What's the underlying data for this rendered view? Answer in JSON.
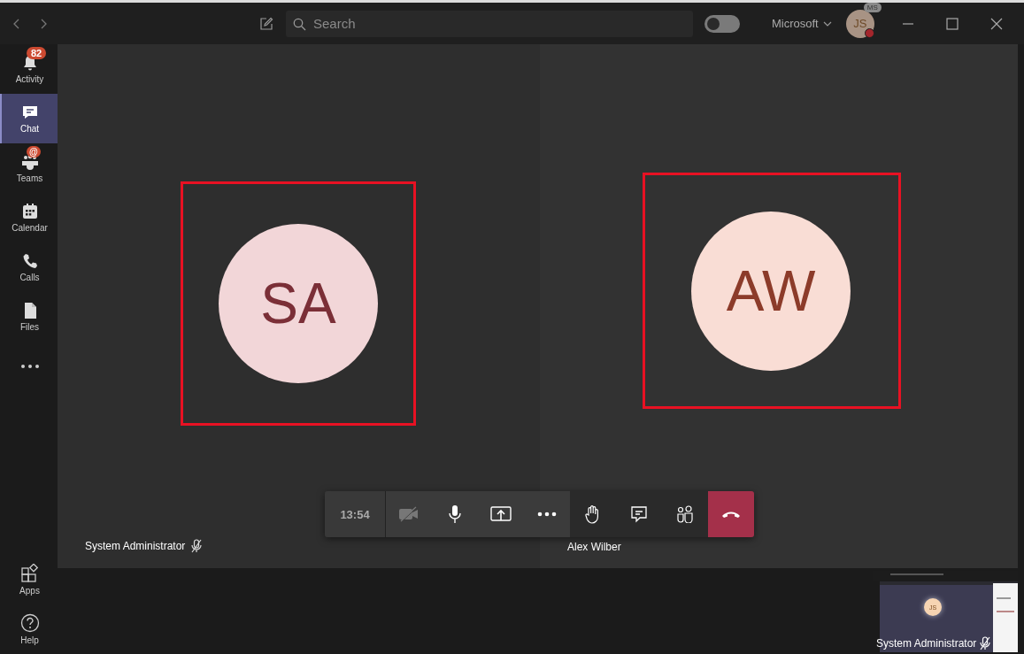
{
  "title_bar": {
    "search_placeholder": "Search",
    "toggle_on": false,
    "org": "Microsoft",
    "avatar_initials": "JS",
    "avatar_badge": "MS"
  },
  "rail": {
    "items": [
      {
        "kind": "bell",
        "label": "Activity",
        "badge": "82",
        "selected": false
      },
      {
        "kind": "chat",
        "label": "Chat",
        "selected": true
      },
      {
        "kind": "teams",
        "label": "Teams",
        "badge": "@",
        "selected": false
      },
      {
        "kind": "calendar",
        "label": "Calendar",
        "selected": false
      },
      {
        "kind": "calls",
        "label": "Calls",
        "selected": false
      },
      {
        "kind": "files",
        "label": "Files",
        "selected": false
      },
      {
        "kind": "more",
        "selected": false
      }
    ],
    "bottom_items": [
      {
        "kind": "apps",
        "label": "Apps",
        "selected": false
      },
      {
        "kind": "help",
        "label": "Help",
        "selected": false
      }
    ]
  },
  "participants": [
    {
      "initials": "SA",
      "name": "System Administrator",
      "muted": true,
      "color": "#f2d6d8"
    },
    {
      "initials": "AW",
      "name": "Alex Wilber",
      "muted": false,
      "color": "#f9ddd5"
    }
  ],
  "call_controls": {
    "timer": "13:54",
    "camera_on": false,
    "mic_on": true
  },
  "self_view": {
    "initials": "JS",
    "name": "System Administrator",
    "muted": true
  }
}
